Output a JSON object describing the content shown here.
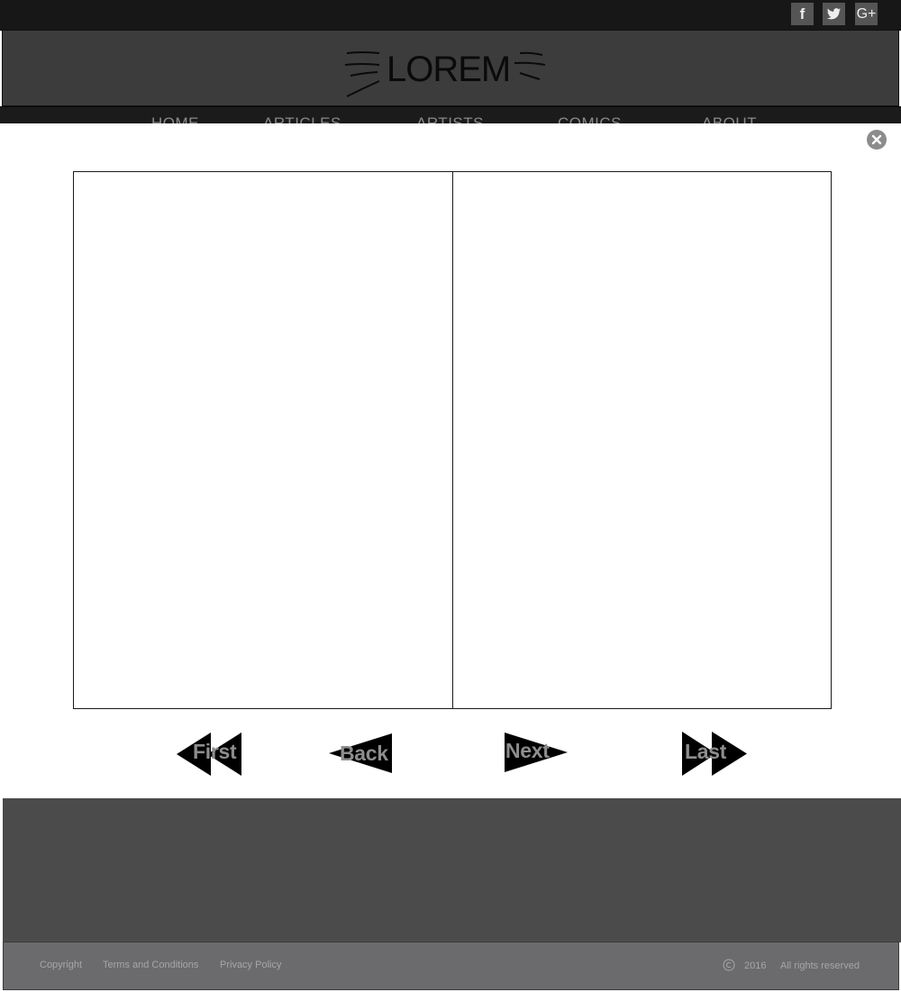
{
  "social": {
    "facebook_glyph": "f",
    "googleplus_glyph": "G+"
  },
  "header": {
    "logo_text": "LOREM"
  },
  "nav": {
    "items": [
      {
        "label": "HOME"
      },
      {
        "label": "ARTICLES"
      },
      {
        "label": "ARTISTS"
      },
      {
        "label": "COMICS"
      },
      {
        "label": "ABOUT"
      }
    ]
  },
  "pager": {
    "first_label": "First",
    "back_label": "Back",
    "next_label": "Next",
    "last_label": "Last"
  },
  "footer": {
    "links": [
      {
        "label": "Copyright"
      },
      {
        "label": "Terms and Conditions"
      },
      {
        "label": "Privacy Policy"
      }
    ],
    "year": "2016",
    "rights": "All rights reserved"
  },
  "icons": {
    "close": "close-icon",
    "copyright": "copyright-icon",
    "twitter": "twitter-icon",
    "facebook": "facebook-icon",
    "googleplus": "googleplus-icon"
  },
  "colors": {
    "topbar": "#171717",
    "header": "#3c3c3c",
    "footer": "#4b4b4b",
    "footer_bar": "#6b6b6d",
    "pager_arrow": "#000000",
    "pager_text": "#8d8d8d"
  }
}
